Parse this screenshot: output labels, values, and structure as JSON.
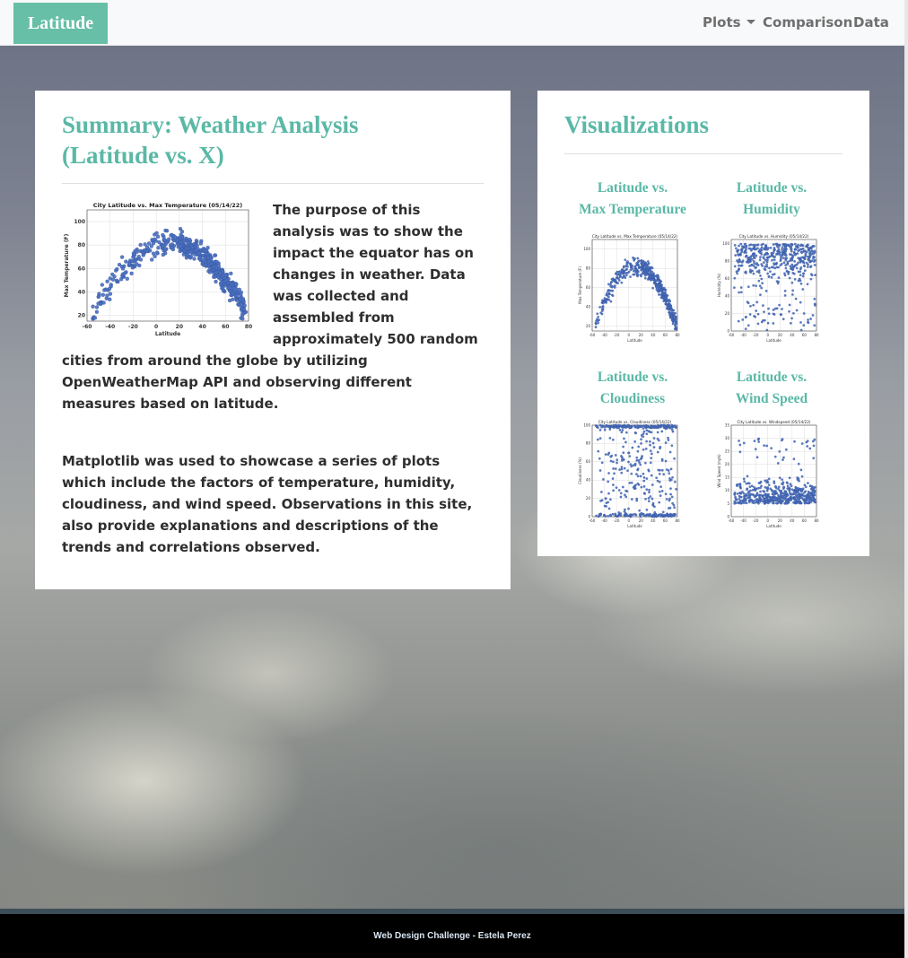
{
  "navbar": {
    "brand": "Latitude",
    "items": [
      {
        "label": "Plots",
        "dropdown": true
      },
      {
        "label": "Comparison"
      },
      {
        "label": "Data"
      }
    ]
  },
  "summary": {
    "title_line1": "Summary: Weather Analysis",
    "title_line2": "(Latitude vs. X)",
    "paragraph1": "The purpose of this analysis was to show the impact the equator has on changes in weather. Data was collected and assembled from approximately 500 random cities from around the globe by utilizing OpenWeatherMap API and observing different measures based on latitude.",
    "paragraph2": "Matplotlib was used to showcase a series of plots which include the factors of temperature, humidity, cloudiness, and wind speed. Observations in this site, also provide explanations and descriptions of the trends and correlations observed."
  },
  "visualizations": {
    "title": "Visualizations",
    "items": [
      {
        "line1": "Latitude vs.",
        "line2": "Max Temperature"
      },
      {
        "line1": "Latitude vs.",
        "line2": "Humidity"
      },
      {
        "line1": "Latitude vs.",
        "line2": "Cloudiness"
      },
      {
        "line1": "Latitude vs.",
        "line2": "Wind Speed"
      }
    ]
  },
  "chart_data": [
    {
      "type": "scatter",
      "title": "City Latitude vs. Max Temperature (05/14/22)",
      "xlabel": "Latitude",
      "ylabel": "Max Temperature (F)",
      "xlim": [
        -60,
        80
      ],
      "ylim": [
        15,
        110
      ],
      "xticks": [
        -60,
        -40,
        -20,
        0,
        20,
        40,
        60,
        80
      ],
      "yticks": [
        20,
        40,
        60,
        80,
        100
      ],
      "grid": true,
      "pattern": "inverted-u",
      "series": [
        {
          "color": "#4a6fbf",
          "points": 500
        }
      ]
    },
    {
      "type": "scatter",
      "title": "City Latitude vs. Humidity (05/14/22)",
      "xlabel": "Latitude",
      "ylabel": "Humidity (%)",
      "xlim": [
        -60,
        80
      ],
      "ylim": [
        0,
        105
      ],
      "xticks": [
        -60,
        -40,
        -20,
        0,
        20,
        40,
        60,
        80
      ],
      "yticks": [
        0,
        20,
        40,
        60,
        80,
        100
      ],
      "grid": true,
      "pattern": "dense-high",
      "series": [
        {
          "color": "#4a6fbf",
          "points": 500
        }
      ]
    },
    {
      "type": "scatter",
      "title": "City Latitude vs. Cloudiness (05/14/22)",
      "xlabel": "Latitude",
      "ylabel": "Cloudiness (%)",
      "xlim": [
        -60,
        80
      ],
      "ylim": [
        0,
        100
      ],
      "xticks": [
        -60,
        -40,
        -20,
        0,
        20,
        40,
        60,
        80
      ],
      "yticks": [
        0,
        20,
        40,
        60,
        80,
        100
      ],
      "grid": true,
      "pattern": "bands-0-100",
      "series": [
        {
          "color": "#4a6fbf",
          "points": 500
        }
      ]
    },
    {
      "type": "scatter",
      "title": "City Latitude vs. Windspeed (05/14/22)",
      "xlabel": "Latitude",
      "ylabel": "Wind Speed (mph)",
      "xlim": [
        -60,
        80
      ],
      "ylim": [
        0,
        35
      ],
      "xticks": [
        -60,
        -40,
        -20,
        0,
        20,
        40,
        60,
        80
      ],
      "yticks": [
        0,
        5,
        10,
        15,
        20,
        25,
        30,
        35
      ],
      "grid": true,
      "pattern": "low-spread",
      "series": [
        {
          "color": "#4a6fbf",
          "points": 500
        }
      ]
    }
  ],
  "footer": {
    "text": "Web Design Challenge - Estela Perez"
  }
}
